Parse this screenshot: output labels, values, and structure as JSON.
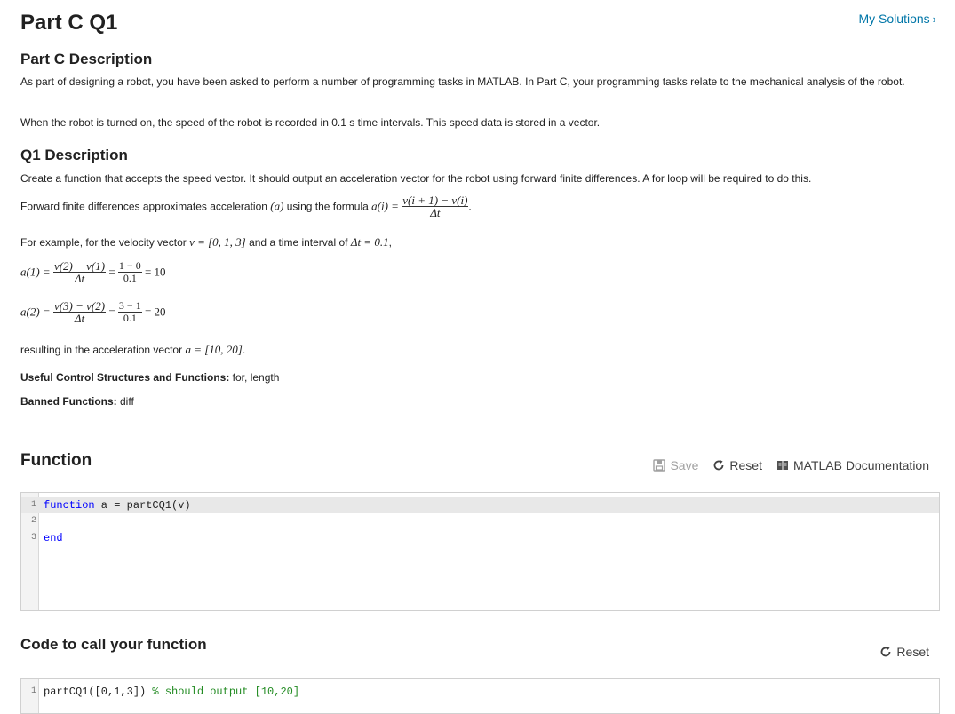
{
  "page": {
    "title": "Part C Q1",
    "my_solutions": "My Solutions",
    "chevron": "›"
  },
  "part_c": {
    "heading": "Part C Description",
    "para1": "As part of designing a robot, you have been asked to perform a number of programming tasks in MATLAB.  In Part C, your programming tasks relate to the mechanical analysis of the robot.",
    "para2": "When the robot is turned on, the speed of the robot is recorded in 0.1 s time intervals. This speed data is stored in a vector."
  },
  "q1": {
    "heading": "Q1 Description",
    "para1": "Create a function that accepts the speed vector. It should output an acceleration vector for the robot using forward finite differences. A for loop will be required to do this.",
    "formula_intro": "Forward finite differences approximates acceleration ",
    "formula_var": "(a)",
    "formula_mid": " using the formula ",
    "formula_lhs": "a(i) =",
    "formula_num": "v(i + 1) − v(i)",
    "formula_den": "Δt",
    "example_intro": "For example, for the velocity vector ",
    "example_v": "v = [0, 1, 3]",
    "example_mid": " and a time interval of ",
    "example_dt": "Δt = 0.1",
    "eq1": {
      "lhs": "a(1) =",
      "num1": "v(2) − v(1)",
      "den1": "Δt",
      "num2": "1 − 0",
      "den2": "0.1",
      "result": "= 10"
    },
    "eq2": {
      "lhs": "a(2) =",
      "num1": "v(3) − v(2)",
      "den1": "Δt",
      "num2": "3 − 1",
      "den2": "0.1",
      "result": "= 20"
    },
    "resulting_text": "resulting in the acceleration vector ",
    "resulting_vec": "a = [10, 20]",
    "useful_label": "Useful Control Structures and Functions:",
    "useful_value": " for, length",
    "banned_label": "Banned Functions:",
    "banned_value": " diff"
  },
  "function_section": {
    "title": "Function",
    "save": "Save",
    "reset": "Reset",
    "docs": "MATLAB Documentation",
    "lines": [
      {
        "n": "1",
        "kw": "function",
        "rest": " a = partCQ1(v)"
      },
      {
        "n": "2",
        "kw": "",
        "rest": ""
      },
      {
        "n": "3",
        "kw": "end",
        "rest": ""
      }
    ]
  },
  "call_section": {
    "title": "Code to call your function",
    "reset": "Reset",
    "line_n": "1",
    "code": "partCQ1([0,1,3]) ",
    "comment": "% should output [10,20]"
  },
  "colors": {
    "link": "#0076a8",
    "keyword": "#0000ff",
    "comment": "#228b22"
  }
}
